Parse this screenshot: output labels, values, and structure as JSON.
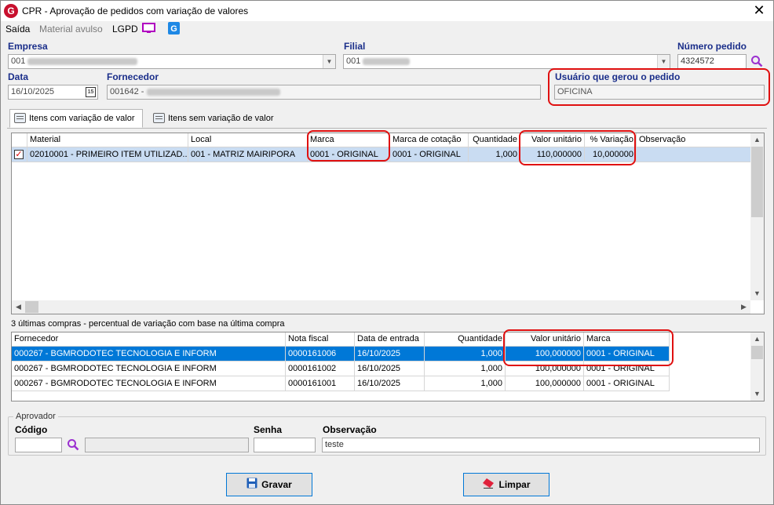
{
  "window": {
    "title": "CPR - Aprovação de pedidos com variação de valores",
    "app_icon": "G",
    "close": "✕"
  },
  "menu": {
    "saida": "Saída",
    "material_avulso": "Material avulso",
    "lgpd": "LGPD"
  },
  "header": {
    "empresa_label": "Empresa",
    "empresa_value": "001",
    "filial_label": "Filial",
    "filial_value": "001",
    "numero_label": "Número pedido",
    "numero_value": "4324572",
    "data_label": "Data",
    "data_value": "16/10/2025",
    "calendar_glyph": "15",
    "fornecedor_label": "Fornecedor",
    "fornecedor_value": "001642 -",
    "usuario_label": "Usuário que gerou o pedido",
    "usuario_value": "OFICINA"
  },
  "tabs": [
    {
      "label": "Itens com variação de valor"
    },
    {
      "label": "Itens sem variação de valor"
    }
  ],
  "items_grid": {
    "columns": [
      "Material",
      "Local",
      "Marca",
      "Marca de cotação",
      "Quantidade",
      "Valor unitário",
      "% Variação",
      "Observação"
    ],
    "rows": [
      {
        "checked": "✓",
        "material": "02010001 - PRIMEIRO ITEM UTILIZAD...",
        "local": "001 - MATRIZ MAIRIPORA",
        "marca": "0001 - ORIGINAL",
        "marca_cotacao": "0001 - ORIGINAL",
        "quantidade": "1,000",
        "valor_unitario": "110,000000",
        "variacao": "10,000000",
        "observacao": ""
      }
    ]
  },
  "history": {
    "caption": "3 últimas compras - percentual de variação com base na última compra",
    "columns": [
      "Fornecedor",
      "Nota fiscal",
      "Data de entrada",
      "Quantidade",
      "Valor unitário",
      "Marca"
    ],
    "rows": [
      {
        "fornecedor": "000267 - BGMRODOTEC TECNOLOGIA E INFORM",
        "nota": "0000161006",
        "data": "16/10/2025",
        "quantidade": "1,000",
        "valor": "100,000000",
        "marca": "0001 - ORIGINAL"
      },
      {
        "fornecedor": "000267 - BGMRODOTEC TECNOLOGIA E INFORM",
        "nota": "0000161002",
        "data": "16/10/2025",
        "quantidade": "1,000",
        "valor": "100,000000",
        "marca": "0001 - ORIGINAL"
      },
      {
        "fornecedor": "000267 - BGMRODOTEC TECNOLOGIA E INFORM",
        "nota": "0000161001",
        "data": "16/10/2025",
        "quantidade": "1,000",
        "valor": "100,000000",
        "marca": "0001 - ORIGINAL"
      }
    ]
  },
  "aprovador": {
    "group_title": "Aprovador",
    "codigo_label": "Código",
    "codigo_value": "",
    "senha_label": "Senha",
    "senha_value": "",
    "observacao_label": "Observação",
    "observacao_value": "teste"
  },
  "buttons": {
    "gravar": "Gravar",
    "limpar": "Limpar"
  },
  "colors": {
    "selection_blue": "#0078d7",
    "selection_light": "#c9dcf2",
    "label_blue": "#1a2e8a",
    "highlight_red": "#e01010"
  }
}
